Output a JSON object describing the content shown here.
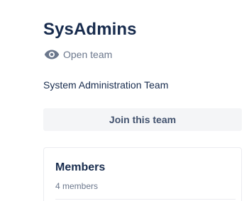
{
  "team": {
    "name": "SysAdmins",
    "visibility": {
      "icon": "eye-icon",
      "label": "Open team"
    },
    "description": "System Administration Team",
    "join_label": "Join this team"
  },
  "members": {
    "heading": "Members",
    "count_label": "4 members"
  },
  "colors": {
    "title": "#172b4d",
    "muted": "#6b778c",
    "button_bg": "#f4f5f7",
    "button_text": "#42526e",
    "border": "#ebecf0"
  }
}
